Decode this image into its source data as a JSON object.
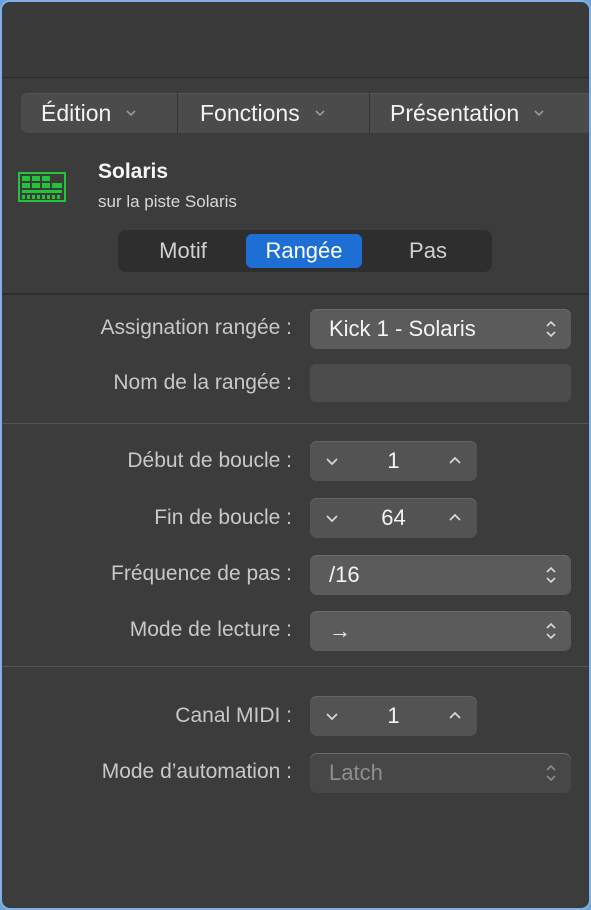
{
  "menubar": {
    "items": [
      {
        "label": "Édition"
      },
      {
        "label": "Fonctions"
      },
      {
        "label": "Présentation"
      }
    ]
  },
  "header": {
    "icon": "step-sequencer-icon",
    "title": "Solaris",
    "subtitle": "sur la piste Solaris",
    "tabs": [
      {
        "label": "Motif",
        "active": false
      },
      {
        "label": "Rangée",
        "active": true
      },
      {
        "label": "Pas",
        "active": false
      }
    ]
  },
  "row_settings": {
    "assignation": {
      "label": "Assignation rangée :",
      "value": "Kick 1 - Solaris"
    },
    "name": {
      "label": "Nom de la rangée :",
      "value": ""
    }
  },
  "loop_settings": {
    "start": {
      "label": "Début de boucle :",
      "value": "1"
    },
    "end": {
      "label": "Fin de boucle :",
      "value": "64"
    },
    "rate": {
      "label": "Fréquence de pas :",
      "value": "/16"
    },
    "playback": {
      "label": "Mode de lecture :",
      "value": "→"
    }
  },
  "midi_settings": {
    "channel": {
      "label": "Canal MIDI :",
      "value": "1"
    },
    "automation": {
      "label": "Mode d’automation :",
      "value": "Latch"
    }
  },
  "colors": {
    "accent": "#1e6fd3",
    "icon_green": "#22c43a",
    "panel": "#3c3c3c"
  }
}
